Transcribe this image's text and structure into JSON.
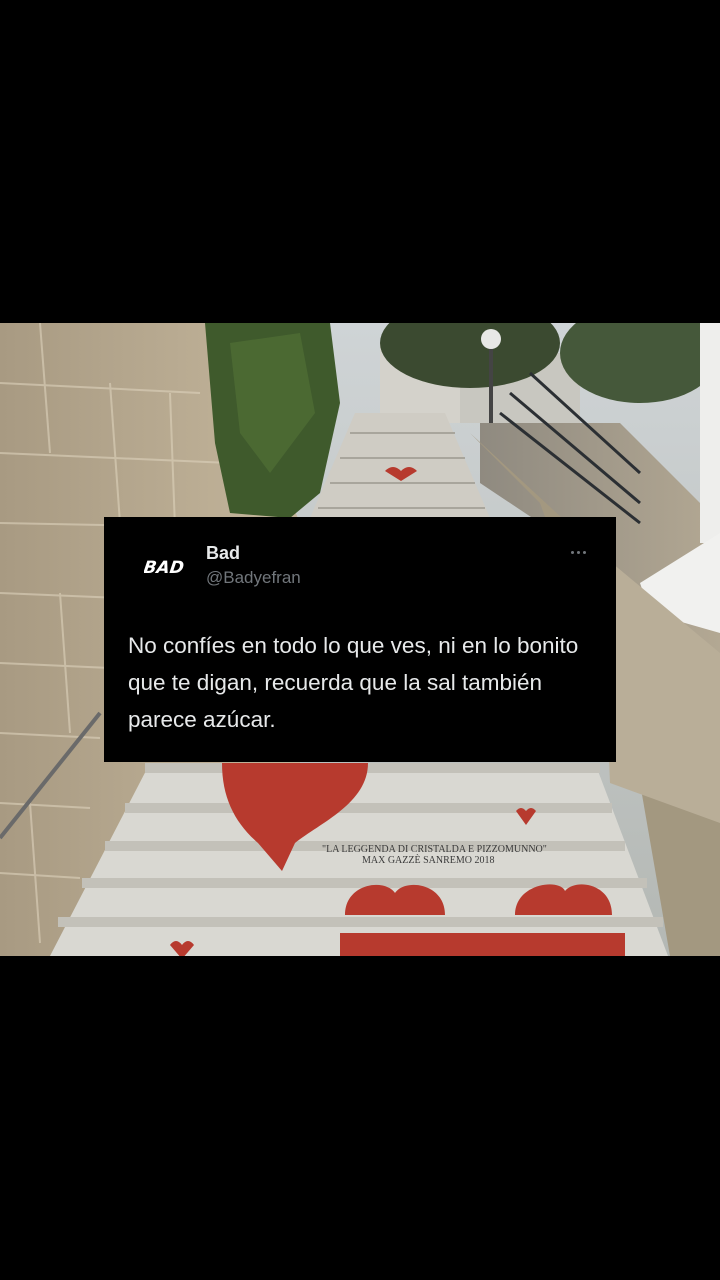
{
  "tweet": {
    "display_name": "Bad",
    "handle": "@Badyefran",
    "avatar_logo_text": "BAD",
    "text": "No confíes en todo lo que ves, ni en lo bonito que te digan, recuerda que la sal también parece azúcar.",
    "more_icon": "more-horizontal-icon"
  },
  "photo": {
    "step_inscription_line1": "\"LA LEGGENDA DI CRISTALDA E PIZZOMUNNO\"",
    "step_inscription_line2": "MAX GAZZÈ  SANREMO 2018",
    "colors": {
      "heart_red": "#b73a2e",
      "wall_stone": "#b9ab92",
      "step_white": "#d9d8d2",
      "foliage_green": "#3f5a2c"
    }
  }
}
